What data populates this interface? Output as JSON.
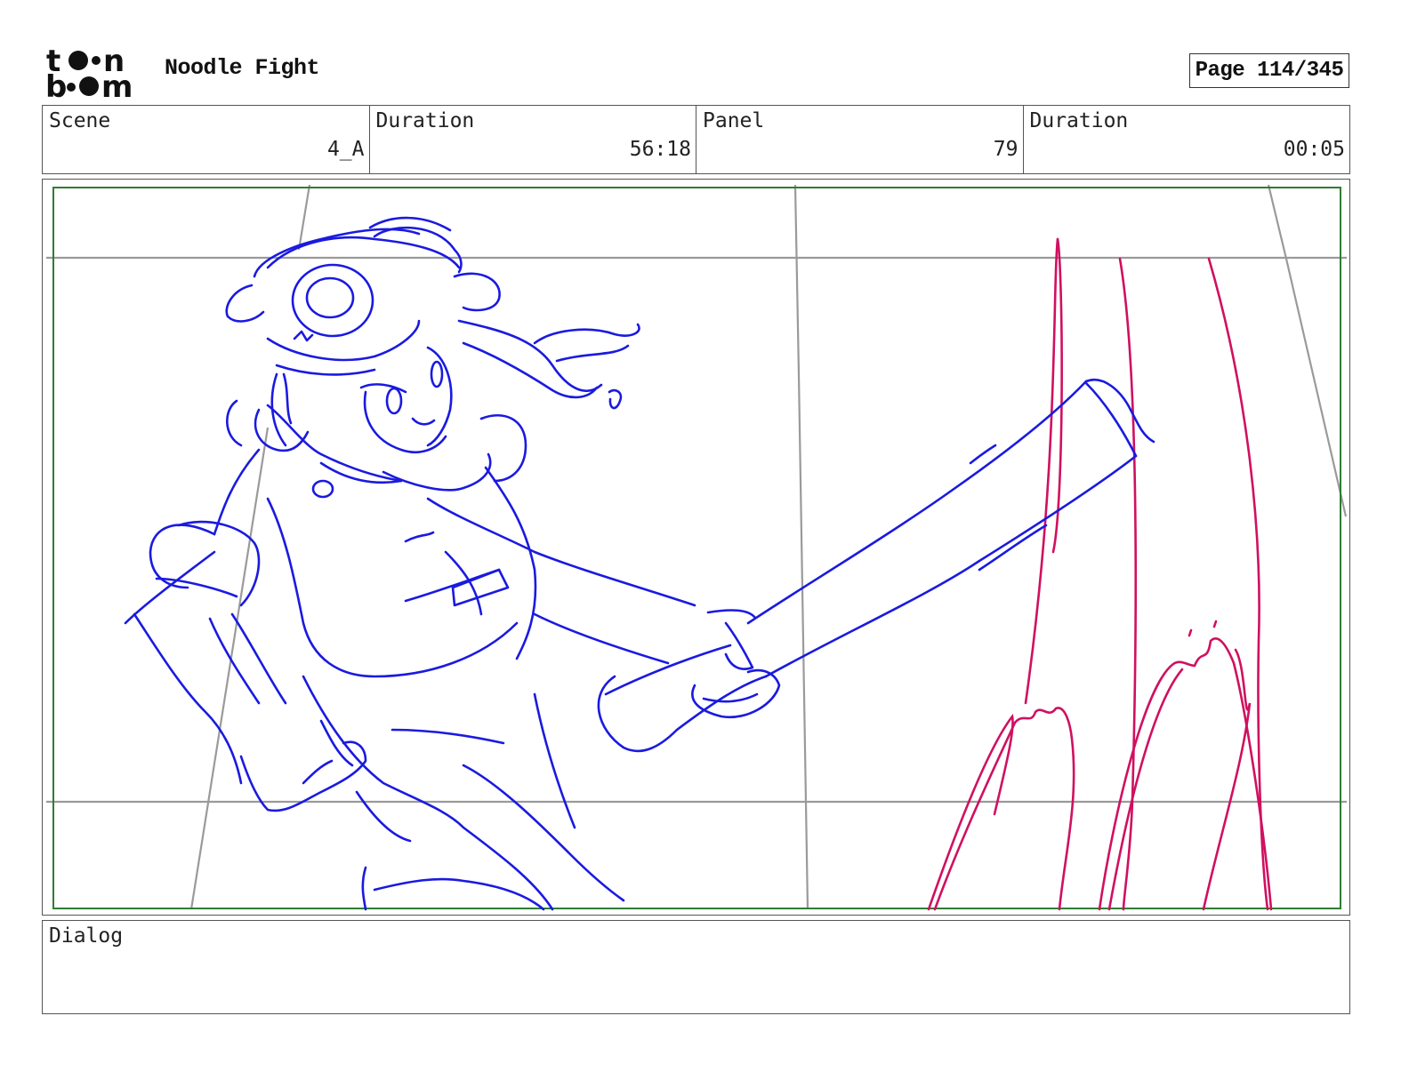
{
  "header": {
    "logo": {
      "text_top": "toon",
      "text_bottom": "boom"
    },
    "project_title": "Noodle Fight",
    "page_indicator": "Page 114/345"
  },
  "info_bar": {
    "scene_label": "Scene",
    "scene_value": "4_A",
    "scene_duration_label": "Duration",
    "scene_duration_value": "56:18",
    "panel_label": "Panel",
    "panel_value": "79",
    "panel_duration_label": "Duration",
    "panel_duration_value": "00:05"
  },
  "panel": {
    "colors": {
      "safe_frame": "#2e7d32",
      "guide_lines": "#9a9a9a",
      "character_sketch": "#1a1ae0",
      "background_sketch": "#d01060"
    }
  },
  "dialog": {
    "label": "Dialog",
    "text": ""
  }
}
